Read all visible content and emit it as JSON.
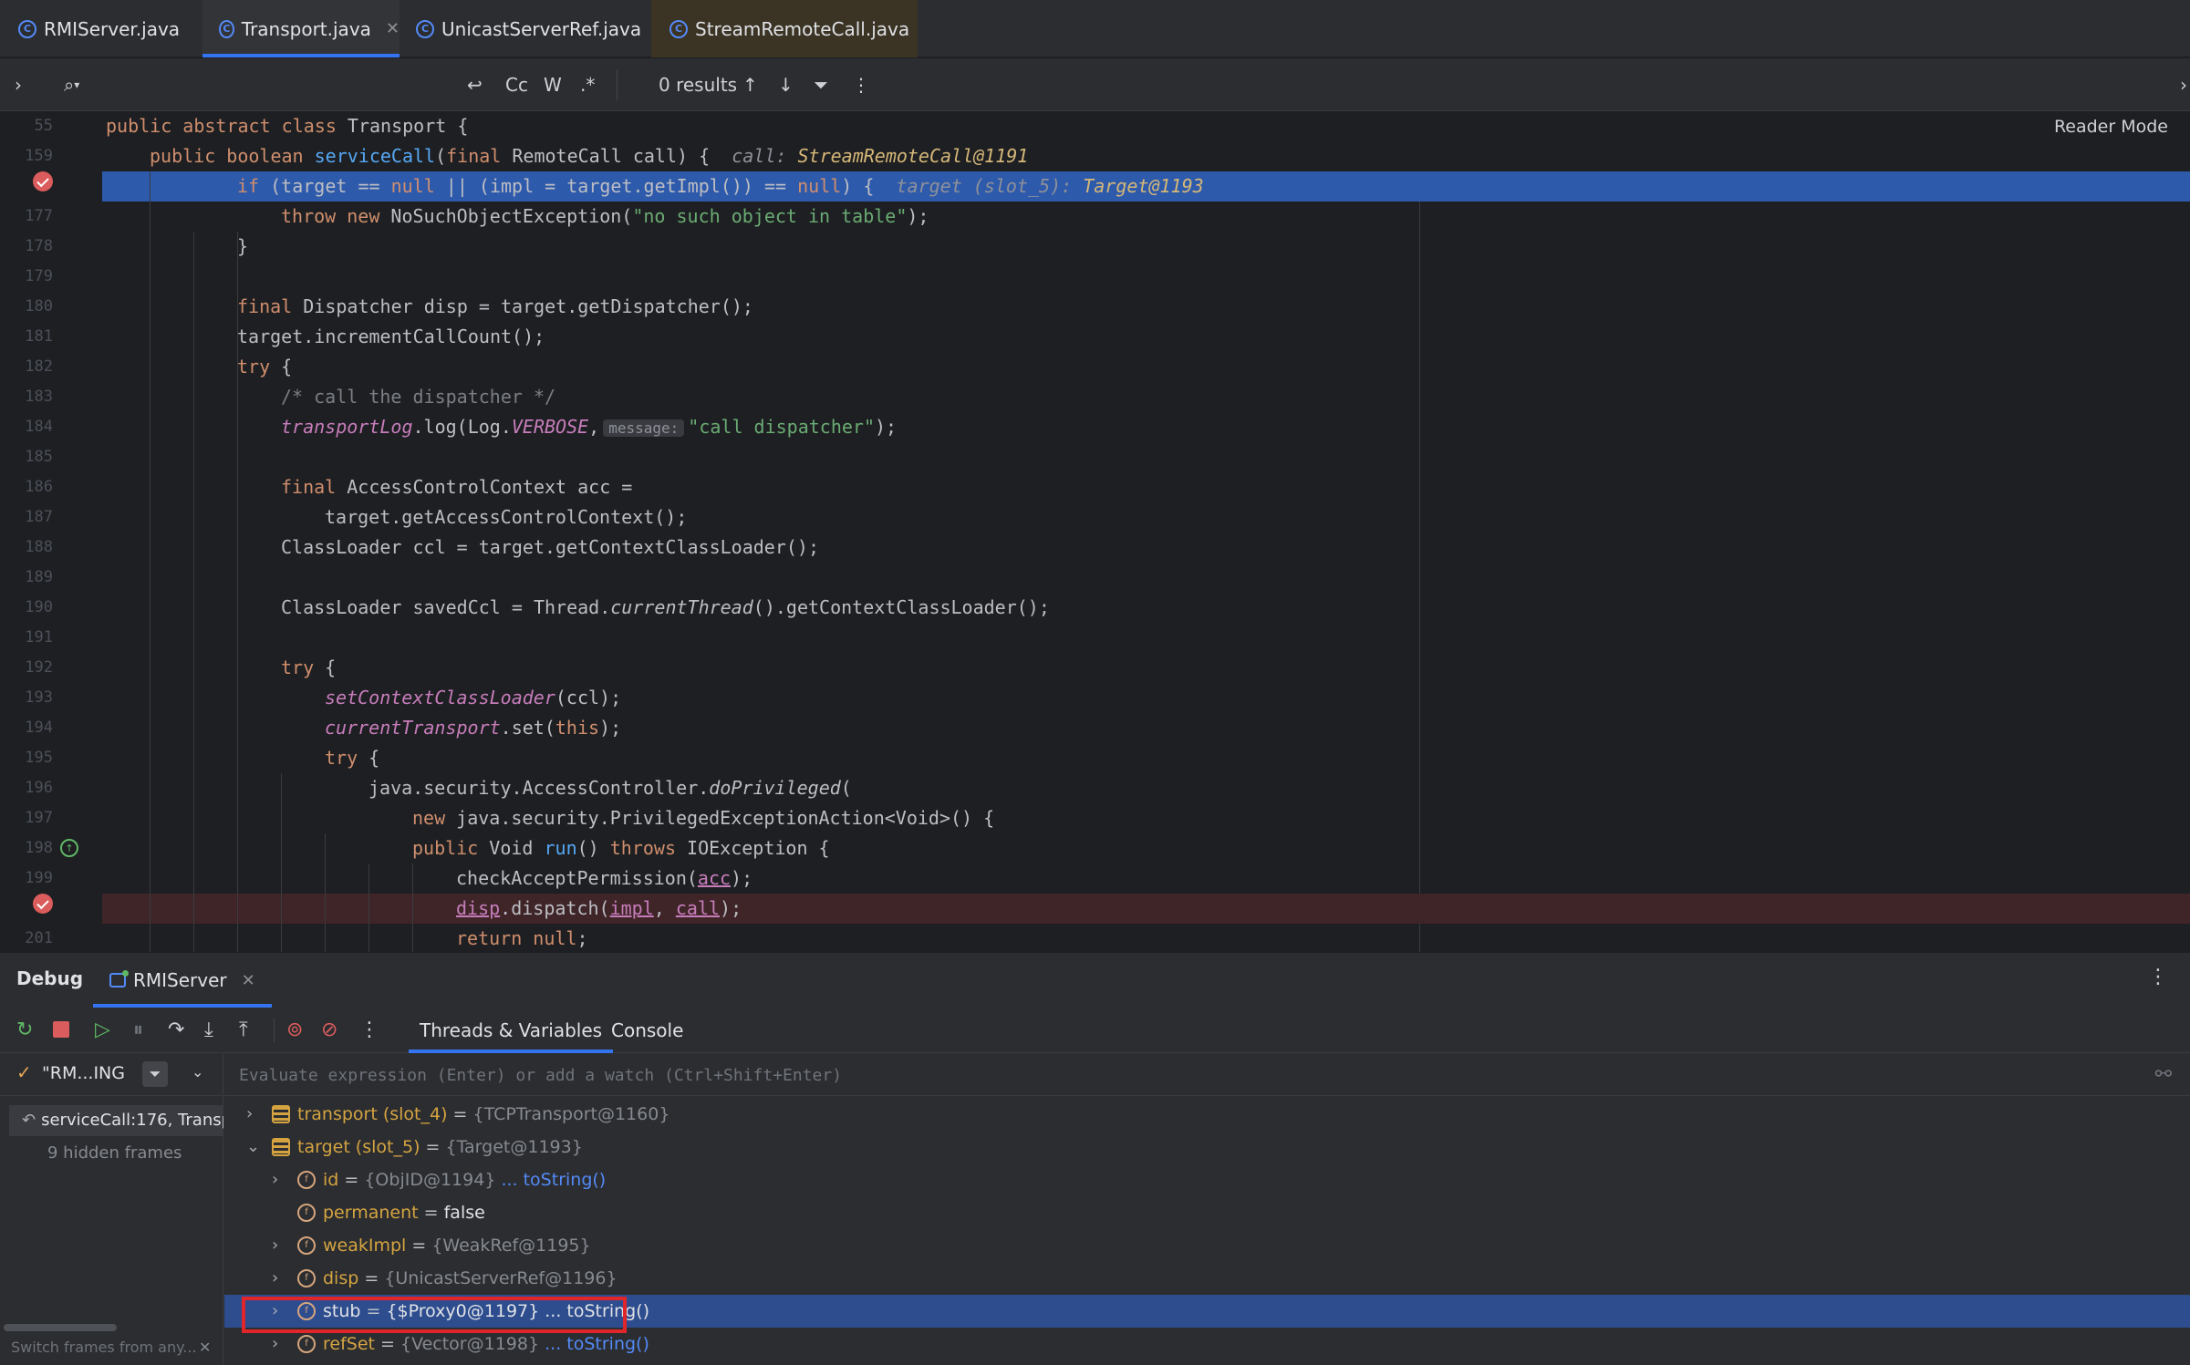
{
  "tabs": [
    {
      "label": "RMIServer.java"
    },
    {
      "label": "Transport.java",
      "active": true
    },
    {
      "label": "UnicastServerRef.java"
    },
    {
      "label": "StreamRemoteCall.java"
    }
  ],
  "findbar": {
    "search_placeholder": "",
    "case_label": "Cc",
    "word_label": "W",
    "regex_label": ".*",
    "results": "0 results"
  },
  "editor": {
    "reader_mode": "Reader Mode",
    "lines": [
      {
        "n": "55"
      },
      {
        "n": "159"
      },
      {
        "n": ""
      },
      {
        "n": "177"
      },
      {
        "n": "178"
      },
      {
        "n": "179"
      },
      {
        "n": "180"
      },
      {
        "n": "181"
      },
      {
        "n": "182"
      },
      {
        "n": "183"
      },
      {
        "n": "184"
      },
      {
        "n": "185"
      },
      {
        "n": "186"
      },
      {
        "n": "187"
      },
      {
        "n": "188"
      },
      {
        "n": "189"
      },
      {
        "n": "190"
      },
      {
        "n": "191"
      },
      {
        "n": "192"
      },
      {
        "n": "193"
      },
      {
        "n": "194"
      },
      {
        "n": "195"
      },
      {
        "n": "196"
      },
      {
        "n": "197"
      },
      {
        "n": "198"
      },
      {
        "n": "199"
      },
      {
        "n": ""
      },
      {
        "n": "201"
      }
    ],
    "code": {
      "l55": {
        "kw": "public abstract class",
        "rest": " Transport {"
      },
      "l159": {
        "kw1": "public boolean",
        "fn": "serviceCall",
        "a": "(",
        "kw2": "final",
        "b": " RemoteCall call) {",
        "hint": "call:",
        "hintval": "StreamRemoteCall@1191"
      },
      "l176": {
        "kw1": "if",
        "a": " (target == ",
        "kw2": "null",
        "b": " || (impl = target.getImpl()) == ",
        "kw3": "null",
        "c": ") {",
        "hint": "target (slot_5):",
        "hintval": "Target@1193"
      },
      "l177": {
        "kw": "throw new",
        "a": " NoSuchObjectException(",
        "str": "\"no such object in table\"",
        "b": ");"
      },
      "l178": {
        "a": "}"
      },
      "l180": {
        "kw": "final",
        "a": " Dispatcher disp = target.getDispatcher();"
      },
      "l181": {
        "a": "target.incrementCallCount();"
      },
      "l182": {
        "kw": "try",
        "a": " {"
      },
      "l183": {
        "cmt": "/* call the dispatcher */"
      },
      "l184": {
        "it": "transportLog",
        "a": ".log(Log.",
        "stat": "VERBOSE",
        "b": ",",
        "param": "message:",
        "str": "\"call dispatcher\"",
        "c": ");"
      },
      "l186": {
        "kw": "final",
        "a": " AccessControlContext acc ="
      },
      "l187": {
        "a": "target.getAccessControlContext();"
      },
      "l188": {
        "a": "ClassLoader ccl = target.getContextClassLoader();"
      },
      "l190": {
        "a": "ClassLoader savedCcl = Thread.",
        "itf": "currentThread",
        "b": "().getContextClassLoader();"
      },
      "l192": {
        "kw": "try",
        "a": " {"
      },
      "l193": {
        "it": "setContextClassLoader",
        "a": "(ccl);"
      },
      "l194": {
        "it": "currentTransport",
        "a": ".set(",
        "kw": "this",
        "b": ");"
      },
      "l195": {
        "kw": "try",
        "a": " {"
      },
      "l196": {
        "a": "java.security.AccessController.",
        "itf": "doPrivileged",
        "b": "("
      },
      "l197": {
        "kw": "new",
        "a": " java.security.PrivilegedExceptionAction<Void>() {"
      },
      "l198": {
        "kw1": "public",
        "a": " Void ",
        "fn": "run",
        "b": "() ",
        "kw2": "throws",
        "c": " IOException {"
      },
      "l199": {
        "a": "checkAcceptPermission(",
        "u": "acc",
        "b": ");"
      },
      "l200": {
        "u1": "disp",
        "a": ".dispatch(",
        "u2": "impl",
        "b": ", ",
        "u3": "call",
        "c": ");"
      },
      "l201": {
        "kw": "return null",
        "a": ";"
      }
    }
  },
  "debug": {
    "title": "Debug",
    "run_tab": "RMIServer",
    "subtabs": {
      "threads": "Threads & Variables",
      "console": "Console"
    },
    "thread": "\"RM...ING",
    "frames": {
      "current": "serviceCall:176, Transp",
      "hidden": "9 hidden frames"
    },
    "footer": "Switch frames from any...",
    "eval_placeholder": "Evaluate expression (Enter) or add a watch (Ctrl+Shift+Enter)",
    "variables": [
      {
        "name": "transport (slot_4)",
        "eq": " = ",
        "val": "{TCPTransport@1160}",
        "link": ""
      },
      {
        "name": "target (slot_5)",
        "eq": " = ",
        "val": "{Target@1193}",
        "link": ""
      },
      {
        "name": "id",
        "eq": " = ",
        "val": "{ObjID@1194}",
        "link": "... toString()"
      },
      {
        "name": "permanent",
        "eq": " = ",
        "val": "false",
        "link": ""
      },
      {
        "name": "weakImpl",
        "eq": " = ",
        "val": "{WeakRef@1195}",
        "link": ""
      },
      {
        "name": "disp",
        "eq": " = ",
        "val": "{UnicastServerRef@1196}",
        "link": ""
      },
      {
        "name": "stub",
        "eq": " = ",
        "val": "{$Proxy0@1197}",
        "link": "... toString()"
      },
      {
        "name": "refSet",
        "eq": " = ",
        "val": "{Vector@1198}",
        "link": "... toString()"
      }
    ]
  },
  "colors": {
    "accent": "#3574f0",
    "highlight_box": "#e0262b",
    "exec_line": "#2e5aab",
    "breakpoint": "#db5c5c"
  }
}
